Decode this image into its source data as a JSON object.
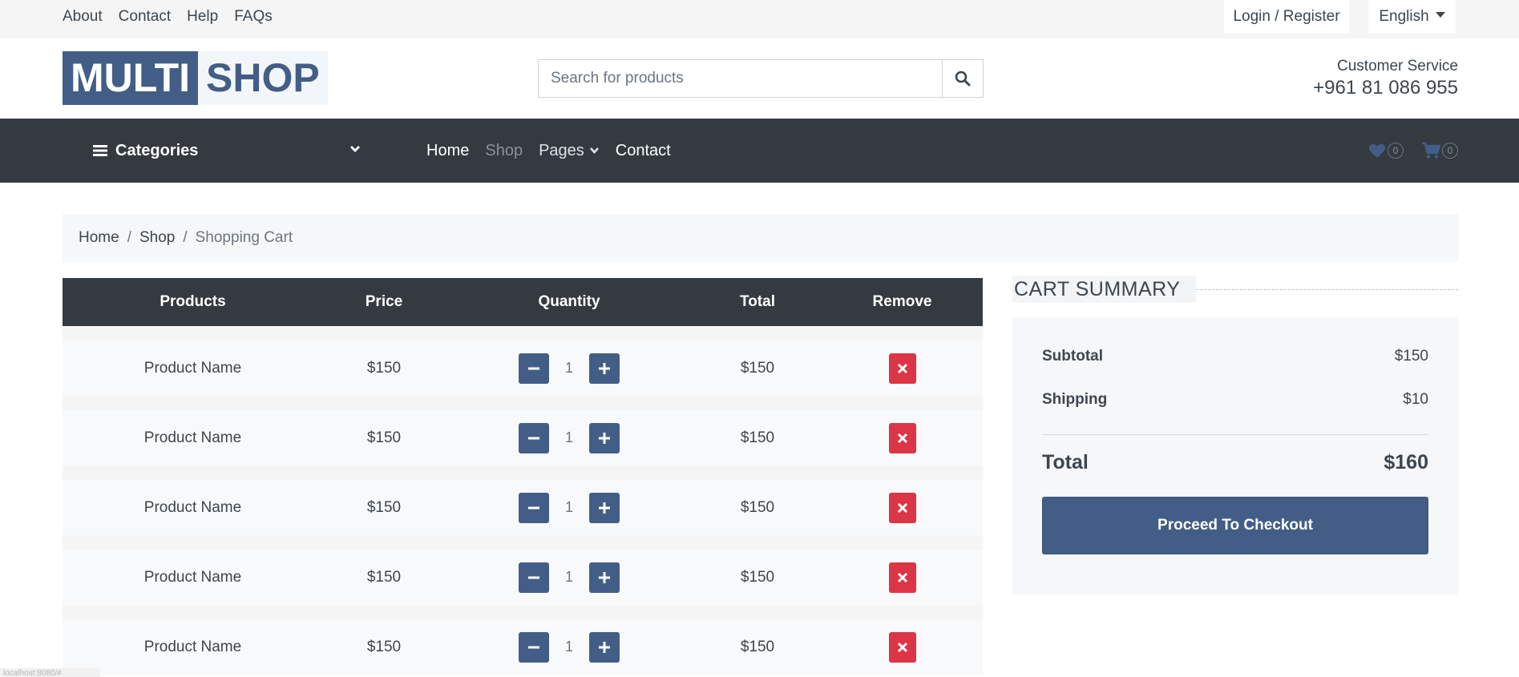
{
  "topbar": {
    "links": [
      "About",
      "Contact",
      "Help",
      "FAQs"
    ],
    "login_label": "Login / Register",
    "language": "English"
  },
  "logo": {
    "part1": "MULTI",
    "part2": "SHOP"
  },
  "search": {
    "placeholder": "Search for products",
    "value": ""
  },
  "customer_service": {
    "label": "Customer Service",
    "phone": "+961 81 086 955"
  },
  "navbar": {
    "categories_label": "Categories",
    "links": {
      "home": "Home",
      "shop": "Shop",
      "pages": "Pages",
      "contact": "Contact"
    },
    "wishlist_count": "0",
    "cart_count": "0"
  },
  "breadcrumb": {
    "home": "Home",
    "shop": "Shop",
    "current": "Shopping Cart",
    "separator": "/"
  },
  "cart": {
    "headers": {
      "products": "Products",
      "price": "Price",
      "quantity": "Quantity",
      "total": "Total",
      "remove": "Remove"
    },
    "rows": [
      {
        "name": "Product Name",
        "price": "$150",
        "qty": "1",
        "total": "$150"
      },
      {
        "name": "Product Name",
        "price": "$150",
        "qty": "1",
        "total": "$150"
      },
      {
        "name": "Product Name",
        "price": "$150",
        "qty": "1",
        "total": "$150"
      },
      {
        "name": "Product Name",
        "price": "$150",
        "qty": "1",
        "total": "$150"
      },
      {
        "name": "Product Name",
        "price": "$150",
        "qty": "1",
        "total": "$150"
      }
    ]
  },
  "summary": {
    "title": "CART SUMMARY",
    "subtotal_label": "Subtotal",
    "subtotal_value": "$150",
    "shipping_label": "Shipping",
    "shipping_value": "$10",
    "total_label": "Total",
    "total_value": "$160",
    "checkout_label": "Proceed To Checkout"
  },
  "status_bar": "localhost:8080/#",
  "colors": {
    "primary": "#435E86",
    "dark": "#343A40",
    "danger": "#DC3545",
    "light": "#F5F7F9"
  },
  "icons": {
    "search": "search-icon",
    "menu": "bars-icon",
    "heart": "heart-icon",
    "cart": "shopping-cart-icon",
    "minus": "minus-icon",
    "plus": "plus-icon",
    "remove": "times-icon"
  }
}
